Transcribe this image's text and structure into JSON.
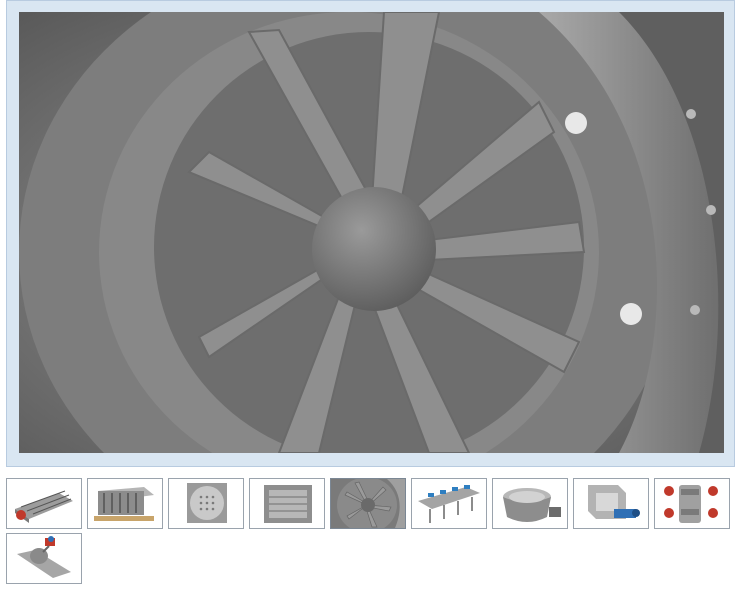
{
  "gallery": {
    "main_image": {
      "icon": "fan-impeller-photo"
    },
    "selected_index": 4,
    "thumbnails": [
      {
        "icon": "louver-damper-assembly"
      },
      {
        "icon": "filter-housing-crate"
      },
      {
        "icon": "round-perforated-plate"
      },
      {
        "icon": "rectangular-frame-damper"
      },
      {
        "icon": "fan-impeller-photo"
      },
      {
        "icon": "multi-blade-damper-rack"
      },
      {
        "icon": "butterfly-valve"
      },
      {
        "icon": "actuated-gate-damper"
      },
      {
        "icon": "inline-damper-with-actuators"
      },
      {
        "icon": "pipe-valve-red-actuator"
      }
    ]
  }
}
